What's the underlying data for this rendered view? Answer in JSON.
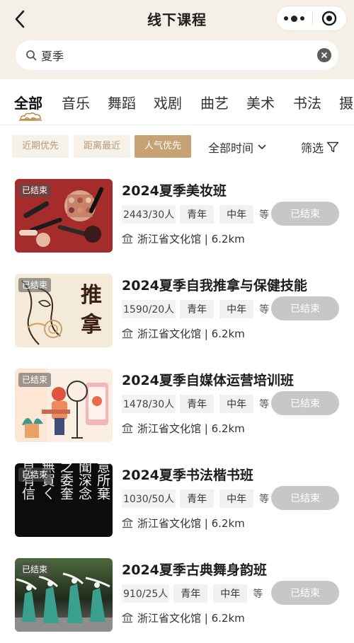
{
  "header": {
    "title": "线下课程"
  },
  "search": {
    "value": "夏季",
    "placeholder": ""
  },
  "tabs": [
    {
      "label": "全部",
      "active": true
    },
    {
      "label": "音乐"
    },
    {
      "label": "舞蹈"
    },
    {
      "label": "戏剧"
    },
    {
      "label": "曲艺"
    },
    {
      "label": "美术"
    },
    {
      "label": "书法"
    },
    {
      "label": "摄"
    }
  ],
  "filters": {
    "sort_options": [
      {
        "label": "近期优先",
        "active": false
      },
      {
        "label": "距离最近",
        "active": false
      },
      {
        "label": "人气优先",
        "active": true
      }
    ],
    "time_dropdown": "全部时间",
    "filter_label": "筛选"
  },
  "courses": [
    {
      "status": "已结束",
      "title": "2024夏季美妆班",
      "enrollment": "2443/30人",
      "tags": [
        "青年",
        "中年"
      ],
      "more": "等",
      "button": "已结束",
      "venue": "浙江省文化馆 | 6.2km"
    },
    {
      "status": "已结束",
      "title": "2024夏季自我推拿与保健技能",
      "enrollment": "1590/20人",
      "tags": [
        "青年",
        "中年"
      ],
      "more": "等",
      "button": "已结束",
      "venue": "浙江省文化馆 | 6.2km",
      "thumb_text": "推拿"
    },
    {
      "status": "已结束",
      "title": "2024夏季自媒体运营培训班",
      "enrollment": "1478/30人",
      "tags": [
        "青年",
        "中年"
      ],
      "more": "等",
      "button": "已结束",
      "venue": "浙江省文化馆 | 6.2km"
    },
    {
      "status": "已结束",
      "title": "2024夏季书法楷书班",
      "enrollment": "1030/50人",
      "tags": [
        "青年",
        "中年"
      ],
      "more": "等",
      "button": "已结束",
      "venue": "浙江省文化馆 | 6.2km",
      "thumb_text": [
        "聖意所棄",
        "獻聞深念",
        "椎之委奎",
        "ㄑ無賀ㄑ",
        "未見有信"
      ]
    },
    {
      "status": "已结束",
      "title": "2024夏季古典舞身韵班",
      "enrollment": "910/25人",
      "tags": [
        "青年",
        "中年"
      ],
      "more": "等",
      "button": "已结束",
      "venue": "浙江省文化馆 | 6.2km"
    }
  ],
  "colors": {
    "header_bg": "#f5f0e7",
    "accent": "#c6a274",
    "chip_off_bg": "#f6f1e9",
    "chip_off_text": "#b69979",
    "ended_button": "#c7c7c7"
  },
  "icons": [
    "back-arrow-icon",
    "more-dots-icon",
    "mini-program-close-icon",
    "search-icon",
    "clear-icon",
    "chevron-down-icon",
    "filter-funnel-icon",
    "venue-building-icon",
    "tab-cloud-ornament-icon"
  ]
}
